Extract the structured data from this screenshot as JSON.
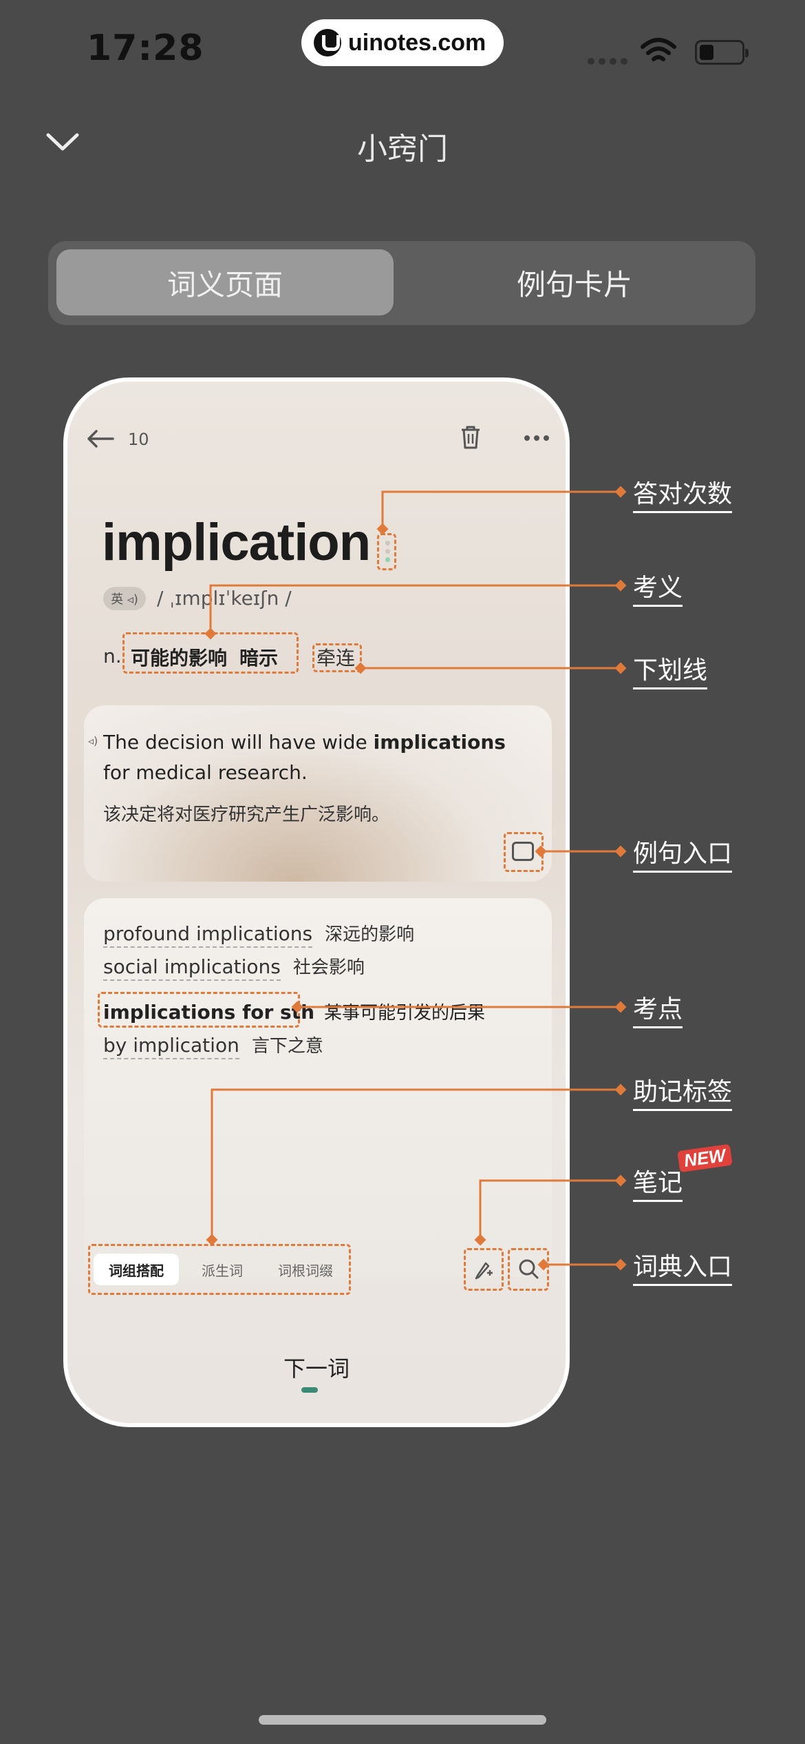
{
  "status_bar": {
    "time": "17:28",
    "brand": "uinotes.com"
  },
  "header": {
    "title": "小窍门",
    "back_icon": "chevron-down-icon"
  },
  "segments": {
    "active": "词义页面",
    "inactive": "例句卡片"
  },
  "phone": {
    "count": "10",
    "word": "implication",
    "lang_badge": "英 ◃)",
    "phonetic": "/ ˌɪmplɪˈkeɪʃn /",
    "pos": "n.",
    "meaning_1": "可能的影响",
    "meaning_2": "暗示",
    "meaning_3": "牵连",
    "example": {
      "en_before": "The decision will have wide ",
      "en_bold": "implications",
      "en_after": " for medical research.",
      "zh": "该决定将对医疗研究产生广泛影响。"
    },
    "collocations": [
      {
        "en": "profound implications",
        "zh": "深远的影响"
      },
      {
        "en": "social implications",
        "zh": "社会影响"
      },
      {
        "en": "implications for sth",
        "zh": "某事可能引发的后果"
      },
      {
        "en": "by implication",
        "zh": "言下之意"
      }
    ],
    "tabs": [
      "词组搭配",
      "派生词",
      "词根词缀"
    ],
    "next_label": "下一词"
  },
  "annotations": {
    "correct_count": "答对次数",
    "test_meaning": "考义",
    "underline": "下划线",
    "example_entry": "例句入口",
    "test_point": "考点",
    "mnemonic_tags": "助记标签",
    "notes": "笔记",
    "new_badge": "NEW",
    "dictionary_entry": "词典入口"
  },
  "colors": {
    "accent": "#e07a3a",
    "background": "#4a4a4a",
    "next_bar": "#3a8a76"
  }
}
